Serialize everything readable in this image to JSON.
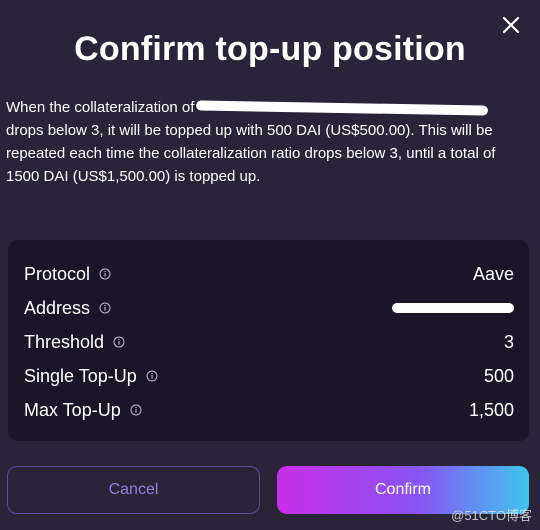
{
  "modal": {
    "title": "Confirm top-up position",
    "description_prefix": "When the collateralization of",
    "description_rest": "drops below 3, it will be topped up with 500 DAI (US$500.00). This will be repeated each time the collateralization ratio drops below 3, until a total of 1500 DAI (US$1,500.00) is topped up."
  },
  "details": [
    {
      "label": "Protocol",
      "value": "Aave"
    },
    {
      "label": "Address",
      "value": ""
    },
    {
      "label": "Threshold",
      "value": "3"
    },
    {
      "label": "Single Top-Up",
      "value": "500"
    },
    {
      "label": "Max Top-Up",
      "value": "1,500"
    }
  ],
  "buttons": {
    "cancel": "Cancel",
    "confirm": "Confirm"
  },
  "watermark": "@51CTO博客",
  "colors": {
    "background": "#2a2438",
    "card": "#1b1627",
    "cancel_border": "#5b4a9e",
    "cancel_text": "#8f7ee0",
    "confirm_gradient": [
      "#c82ee6",
      "#8a52f2",
      "#3ec6f0"
    ]
  }
}
